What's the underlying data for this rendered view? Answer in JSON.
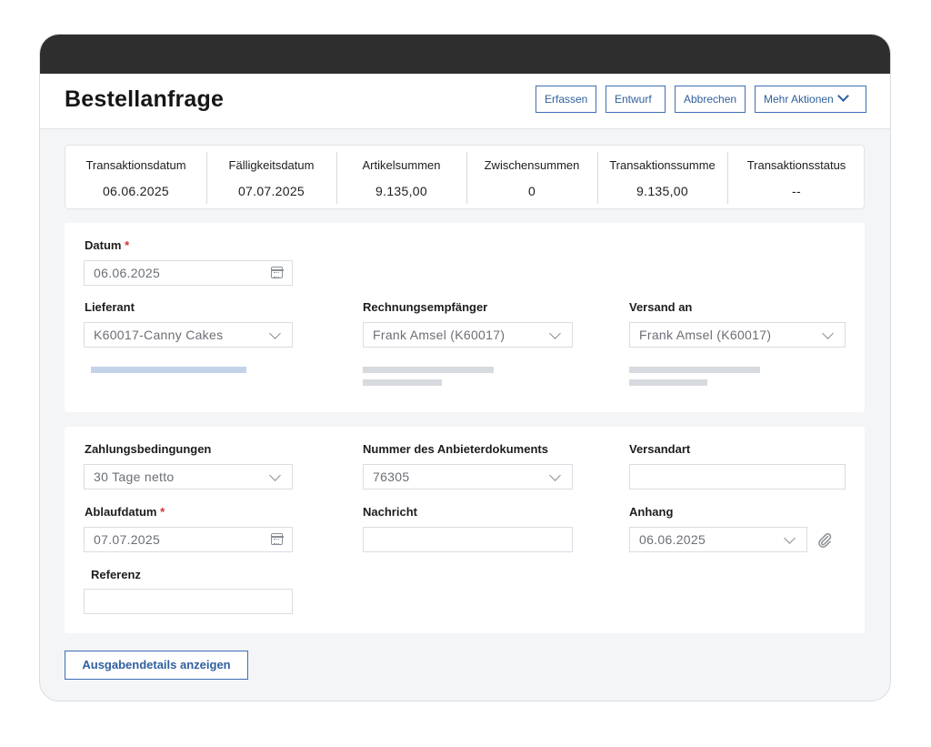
{
  "header": {
    "title": "Bestellanfrage",
    "buttons": {
      "capture": "Erfassen",
      "draft": "Entwurf",
      "cancel": "Abbrechen",
      "more": "Mehr Aktionen"
    }
  },
  "summary": [
    {
      "label": "Transaktionsdatum",
      "value": "06.06.2025"
    },
    {
      "label": "Fälligkeitsdatum",
      "value": "07.07.2025"
    },
    {
      "label": "Artikelsummen",
      "value": "9.135,00"
    },
    {
      "label": "Zwischensummen",
      "value": "0"
    },
    {
      "label": "Transaktionssumme",
      "value": "9.135,00"
    },
    {
      "label": "Transaktionsstatus",
      "value": "--"
    }
  ],
  "section1": {
    "date": {
      "label": "Datum",
      "value": "06.06.2025"
    },
    "supplier": {
      "label": "Lieferant",
      "value": "K60017-Canny Cakes"
    },
    "billTo": {
      "label": "Rechnungsempfänger",
      "value": "Frank Amsel (K60017)"
    },
    "shipTo": {
      "label": "Versand an",
      "value": "Frank Amsel (K60017)"
    }
  },
  "section2": {
    "paymentTerms": {
      "label": "Zahlungsbedingungen",
      "value": "30 Tage netto"
    },
    "vendorDocNumber": {
      "label": "Nummer des Anbieterdokuments",
      "value": "76305"
    },
    "shippingMethod": {
      "label": "Versandart",
      "value": ""
    },
    "expiryDate": {
      "label": "Ablaufdatum",
      "value": "07.07.2025"
    },
    "message": {
      "label": "Nachricht",
      "value": ""
    },
    "attachment": {
      "label": "Anhang",
      "value": "06.06.2025"
    },
    "reference": {
      "label": "Referenz",
      "value": ""
    }
  },
  "required_marker": "*",
  "footer": {
    "show_details": "Ausgabendetails anzeigen"
  },
  "icons": {
    "calendar": "calendar-icon",
    "dropdown": "chevron-down-icon",
    "attachment": "paperclip-icon"
  },
  "colors": {
    "accent": "#3d6fb6",
    "required": "#d32f2f",
    "titlebar": "#2e2e2e"
  }
}
